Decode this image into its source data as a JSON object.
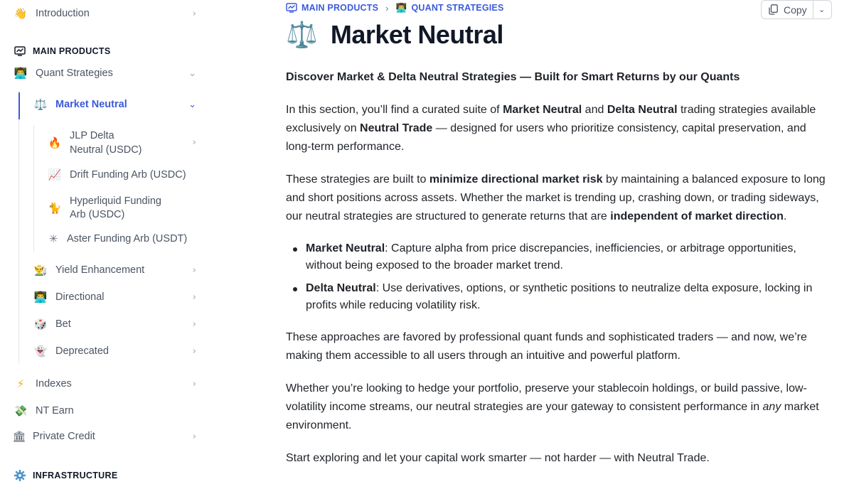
{
  "sidebar": {
    "items": [
      {
        "emoji": "👋",
        "label": "Introduction"
      },
      {
        "emoji": "👨‍💻",
        "label": "Quant Strategies"
      },
      {
        "emoji": "⚖️",
        "label": "Market Neutral"
      },
      {
        "emoji": "🔥",
        "label": "JLP Delta\nNeutral (USDC)"
      },
      {
        "emoji": "📈",
        "label": "Drift Funding Arb (USDC)"
      },
      {
        "emoji": "🐈",
        "label": "Hyperliquid Funding\nArb (USDC)"
      },
      {
        "emoji": "✳",
        "label": "Aster Funding Arb (USDT)"
      },
      {
        "emoji": "👨‍🌾",
        "label": "Yield Enhancement"
      },
      {
        "emoji": "👨‍💻",
        "label": "Directional"
      },
      {
        "emoji": "🎲",
        "label": "Bet"
      },
      {
        "emoji": "👻",
        "label": "Deprecated"
      },
      {
        "emoji": "⚡",
        "label": "Indexes"
      },
      {
        "emoji": "💸",
        "label": "NT Earn"
      },
      {
        "emoji": "🏛",
        "label": "Private Credit"
      }
    ],
    "sections": {
      "main_products": "MAIN PRODUCTS",
      "infrastructure": "INFRASTRUCTURE"
    },
    "chevron_right": "›",
    "chevron_down": "⌄"
  },
  "breadcrumb": {
    "first": "MAIN PRODUCTS",
    "second_emoji": "👨‍💻",
    "second": "QUANT STRATEGIES",
    "separator": "›"
  },
  "copy": {
    "label": "Copy",
    "chevron": "⌄"
  },
  "page": {
    "title_emoji": "⚖️",
    "title": "Market Neutral",
    "lead": "Discover Market & Delta Neutral Strategies — Built for Smart Returns by our Quants",
    "p1": {
      "t1": "In this section, you’ll find a curated suite of ",
      "b1": "Market Neutral",
      "t2": " and ",
      "b2": "Delta Neutral",
      "t3": " trading strategies available exclusively on ",
      "b3": "Neutral Trade",
      "t4": " — designed for users who prioritize consistency, capital preservation, and long-term performance."
    },
    "p2": {
      "t1": "These strategies are built to ",
      "b1": "minimize directional market risk",
      "t2": " by maintaining a balanced exposure to long and short positions across assets. Whether the market is trending up, crashing down, or trading sideways, our neutral strategies are structured to generate returns that are ",
      "b2": "independent of market direction",
      "t3": "."
    },
    "bullets": [
      {
        "term": "Market Neutral",
        "text": ": Capture alpha from price discrepancies, inefficiencies, or arbitrage opportunities, without being exposed to the broader market trend."
      },
      {
        "term": "Delta Neutral",
        "text": ": Use derivatives, options, or synthetic positions to neutralize delta exposure, locking in profits while reducing volatility risk."
      }
    ],
    "p3": "These approaches are favored by professional quant funds and sophisticated traders — and now, we’re making them accessible to all users through an intuitive and powerful platform.",
    "p4": {
      "t1": "Whether you’re looking to hedge your portfolio, preserve your stablecoin holdings, or build passive, low-volatility income streams, our neutral strategies are your gateway to consistent performance in ",
      "em": "any",
      "t2": " market environment."
    },
    "p5": "Start exploring and let your capital work smarter — not harder — with Neutral Trade."
  },
  "colors": {
    "accent": "#3b5bdb",
    "text": "#1f2328",
    "muted": "#4b5563"
  }
}
